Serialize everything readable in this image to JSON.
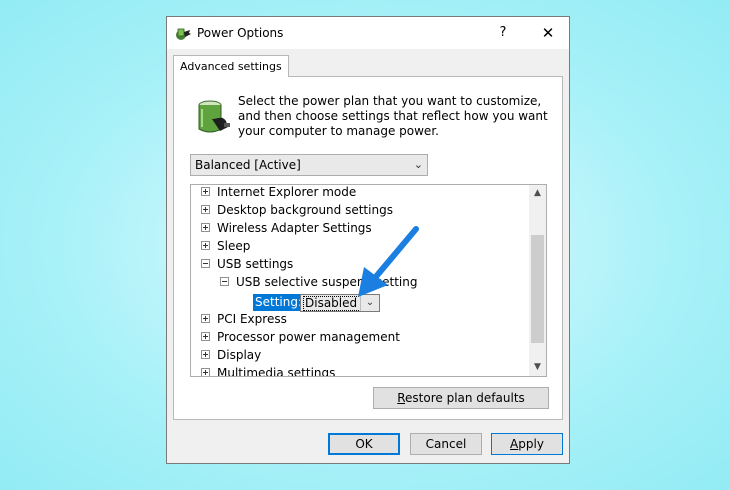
{
  "window": {
    "title": "Power Options",
    "help_label": "?",
    "close_label": "✕"
  },
  "tab": {
    "label": "Advanced settings"
  },
  "description": "Select the power plan that you want to customize, and then choose settings that reflect how you want your computer to manage power.",
  "plan_select": {
    "value": "Balanced [Active]"
  },
  "tree": {
    "items": [
      {
        "label": "Internet Explorer mode",
        "state": "collapsed"
      },
      {
        "label": "Desktop background settings",
        "state": "collapsed"
      },
      {
        "label": "Wireless Adapter Settings",
        "state": "collapsed"
      },
      {
        "label": "Sleep",
        "state": "collapsed"
      },
      {
        "label": "USB settings",
        "state": "expanded"
      },
      {
        "label": "USB selective suspend setting",
        "state": "expanded",
        "level": 1
      },
      {
        "label": "PCI Express",
        "state": "collapsed"
      },
      {
        "label": "Processor power management",
        "state": "collapsed"
      },
      {
        "label": "Display",
        "state": "collapsed"
      },
      {
        "label": "Multimedia settings",
        "state": "collapsed"
      }
    ],
    "setting": {
      "label": "Setting:",
      "value": "Disabled"
    }
  },
  "buttons": {
    "restore_prefix": "R",
    "restore_rest": "estore plan defaults",
    "ok": "OK",
    "cancel": "Cancel",
    "apply_prefix": "A",
    "apply_rest": "pply"
  },
  "colors": {
    "accent": "#0078d7",
    "annotation_arrow": "#1a7fe0",
    "background": "#a8f1f8"
  },
  "icons": {
    "title": "power-options-icon",
    "plan": "battery-plan-icon",
    "annotation": "blue-arrow-annotation"
  }
}
